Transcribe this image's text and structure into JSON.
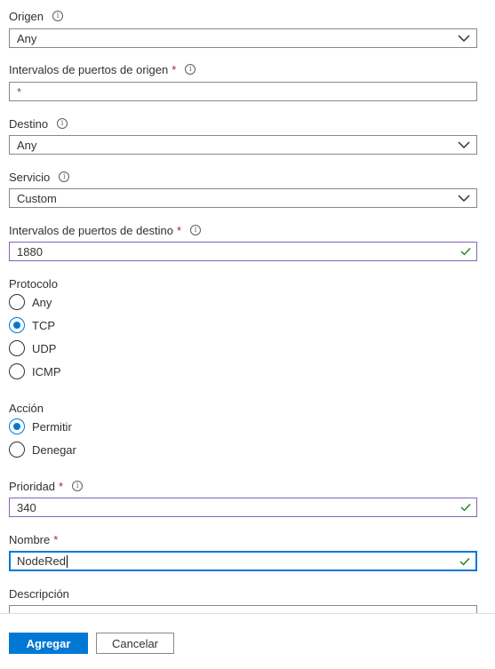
{
  "form": {
    "origen": {
      "label": "Origen",
      "value": "Any"
    },
    "puertos_origen": {
      "label": "Intervalos de puertos de origen",
      "required_mark": "*",
      "placeholder": "*"
    },
    "destino": {
      "label": "Destino",
      "value": "Any"
    },
    "servicio": {
      "label": "Servicio",
      "value": "Custom"
    },
    "puertos_destino": {
      "label": "Intervalos de puertos de destino",
      "required_mark": "*",
      "value": "1880"
    },
    "protocolo": {
      "label": "Protocolo",
      "options": [
        "Any",
        "TCP",
        "UDP",
        "ICMP"
      ],
      "selected": "TCP"
    },
    "accion": {
      "label": "Acción",
      "options": [
        "Permitir",
        "Denegar"
      ],
      "selected": "Permitir"
    },
    "prioridad": {
      "label": "Prioridad",
      "required_mark": "*",
      "value": "340"
    },
    "nombre": {
      "label": "Nombre",
      "required_mark": "*",
      "value": "NodeRed"
    },
    "descripcion": {
      "label": "Descripción",
      "value": ""
    }
  },
  "footer": {
    "add_label": "Agregar",
    "cancel_label": "Cancelar"
  },
  "colors": {
    "primary": "#0078d4",
    "valid_border": "#8764b8",
    "checkmark": "#107c10",
    "required": "#a4262c"
  },
  "icons": {
    "info": "info-icon",
    "dropdown": "chevron-down-icon",
    "valid": "checkmark-icon"
  }
}
